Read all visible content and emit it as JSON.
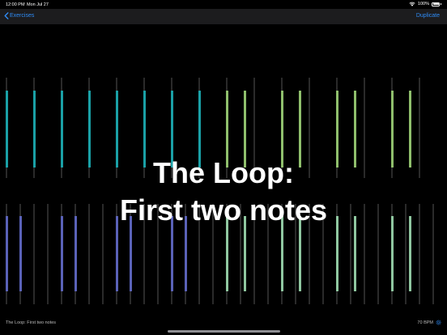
{
  "status_bar": {
    "time": "12:00 PM",
    "date": "Mon Jul 27",
    "battery_percent": "100%",
    "battery_level": 1.0,
    "icons": [
      "wifi-icon",
      "battery-icon"
    ]
  },
  "nav": {
    "back_label": "Exercises",
    "back_icon": "chevron-left-icon",
    "duplicate_label": "Duplicate"
  },
  "title": {
    "line1": "The Loop:",
    "line2": "First two notes"
  },
  "footer": {
    "exercise_name": "The Loop: First two notes",
    "tempo": "70 BPM",
    "tempo_icon": "gear-icon"
  },
  "colors": {
    "accent": "#2f8cf6",
    "teal": "#1aa0a6",
    "green": "#8fbf6c",
    "blue": "#5a62b8",
    "seafoam": "#8fc7a0",
    "grid": "#555555"
  }
}
